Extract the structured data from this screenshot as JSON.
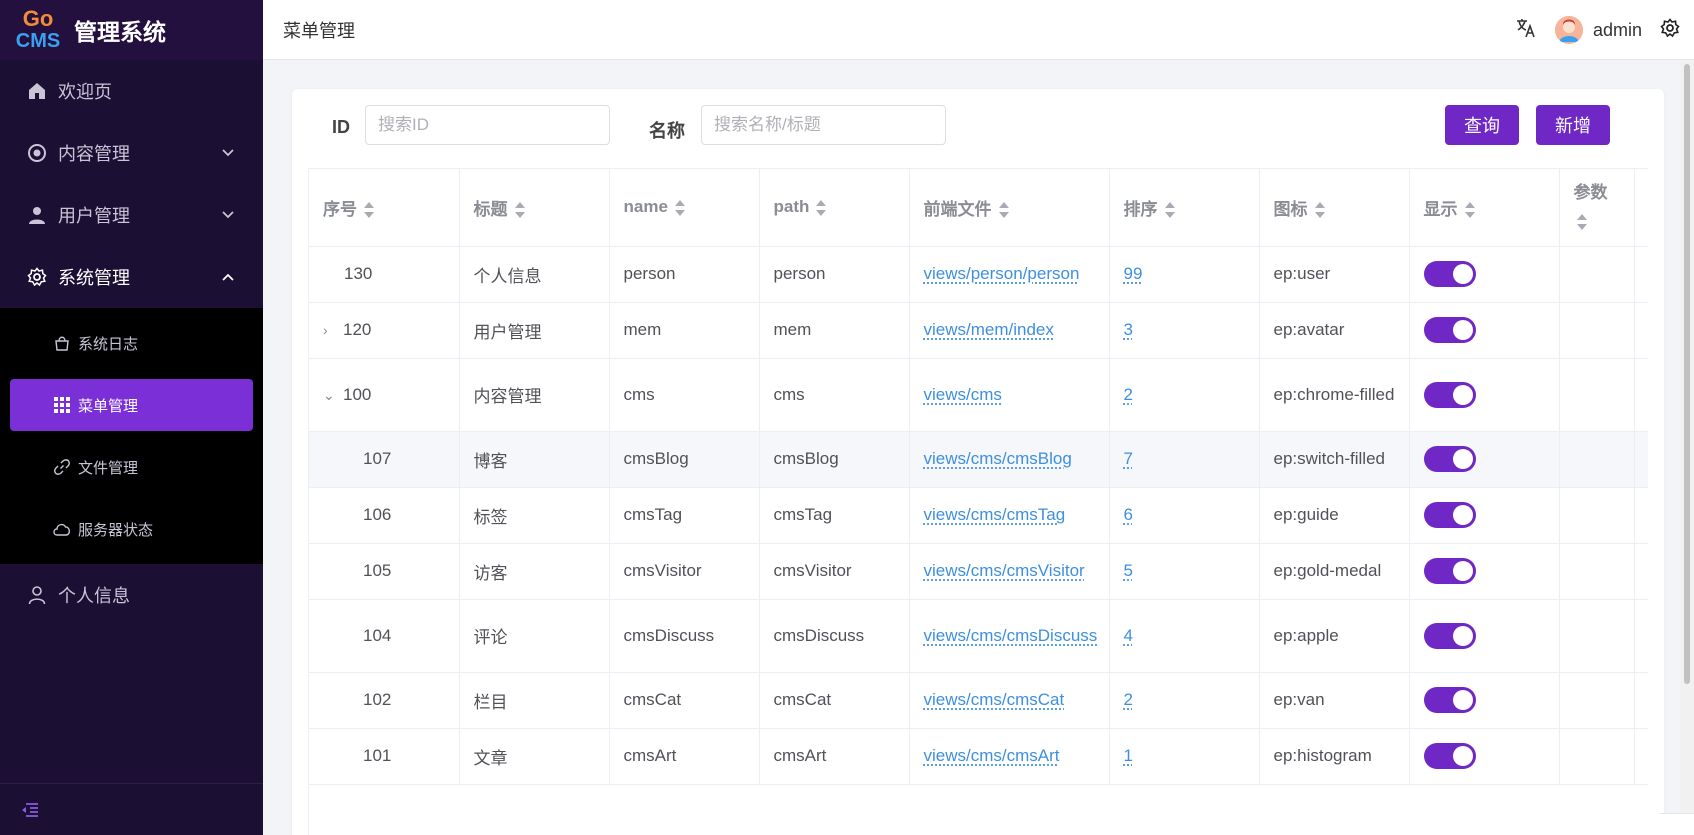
{
  "brand": {
    "logo_top": "Go",
    "logo_bottom": "CMS",
    "title": "管理系统",
    "accent": "#6f27c6"
  },
  "sidebar": {
    "items": [
      {
        "label": "欢迎页",
        "icon": "home-icon"
      },
      {
        "label": "内容管理",
        "icon": "chrome-icon"
      },
      {
        "label": "用户管理",
        "icon": "user-icon"
      },
      {
        "label": "系统管理",
        "icon": "gear-icon"
      }
    ],
    "sub_items": [
      {
        "label": "系统日志",
        "icon": "bag-icon"
      },
      {
        "label": "菜单管理",
        "icon": "grid-icon"
      },
      {
        "label": "文件管理",
        "icon": "link-icon"
      },
      {
        "label": "服务器状态",
        "icon": "cloud-icon"
      }
    ],
    "bottom_item": {
      "label": "个人信息",
      "icon": "person-icon"
    }
  },
  "header": {
    "breadcrumb": "菜单管理",
    "username": "admin"
  },
  "search": {
    "id_label": "ID",
    "id_placeholder": "搜索ID",
    "name_label": "名称",
    "name_placeholder": "搜索名称/标题",
    "query_button": "查询",
    "add_button": "新增"
  },
  "table": {
    "columns": [
      "序号",
      "标题",
      "name",
      "path",
      "前端文件",
      "排序",
      "图标",
      "显示",
      "参数"
    ],
    "rows": [
      {
        "id": "130",
        "title": "个人信息",
        "name": "person",
        "path": "person",
        "file": "views/person/person",
        "order": "99",
        "icon": "ep:user",
        "show": true,
        "expand": "",
        "child": false
      },
      {
        "id": "120",
        "title": "用户管理",
        "name": "mem",
        "path": "mem",
        "file": "views/mem/index",
        "order": "3",
        "icon": "ep:avatar",
        "show": true,
        "expand": ">",
        "child": false
      },
      {
        "id": "100",
        "title": "内容管理",
        "name": "cms",
        "path": "cms",
        "file": "views/cms",
        "order": "2",
        "icon": "ep:chrome-filled",
        "show": true,
        "expand": "v",
        "child": false
      },
      {
        "id": "107",
        "title": "博客",
        "name": "cmsBlog",
        "path": "cmsBlog",
        "file": "views/cms/cmsBlog",
        "order": "7",
        "icon": "ep:switch-filled",
        "show": true,
        "expand": "",
        "child": true
      },
      {
        "id": "106",
        "title": "标签",
        "name": "cmsTag",
        "path": "cmsTag",
        "file": "views/cms/cmsTag",
        "order": "6",
        "icon": "ep:guide",
        "show": true,
        "expand": "",
        "child": true
      },
      {
        "id": "105",
        "title": "访客",
        "name": "cmsVisitor",
        "path": "cmsVisitor",
        "file": "views/cms/cmsVisitor",
        "order": "5",
        "icon": "ep:gold-medal",
        "show": true,
        "expand": "",
        "child": true
      },
      {
        "id": "104",
        "title": "评论",
        "name": "cmsDiscuss",
        "path": "cmsDiscuss",
        "file": "views/cms/cmsDiscuss",
        "order": "4",
        "icon": "ep:apple",
        "show": true,
        "expand": "",
        "child": true
      },
      {
        "id": "102",
        "title": "栏目",
        "name": "cmsCat",
        "path": "cmsCat",
        "file": "views/cms/cmsCat",
        "order": "2",
        "icon": "ep:van",
        "show": true,
        "expand": "",
        "child": true
      },
      {
        "id": "101",
        "title": "文章",
        "name": "cmsArt",
        "path": "cmsArt",
        "file": "views/cms/cmsArt",
        "order": "1",
        "icon": "ep:histogram",
        "show": true,
        "expand": "",
        "child": true
      }
    ]
  }
}
